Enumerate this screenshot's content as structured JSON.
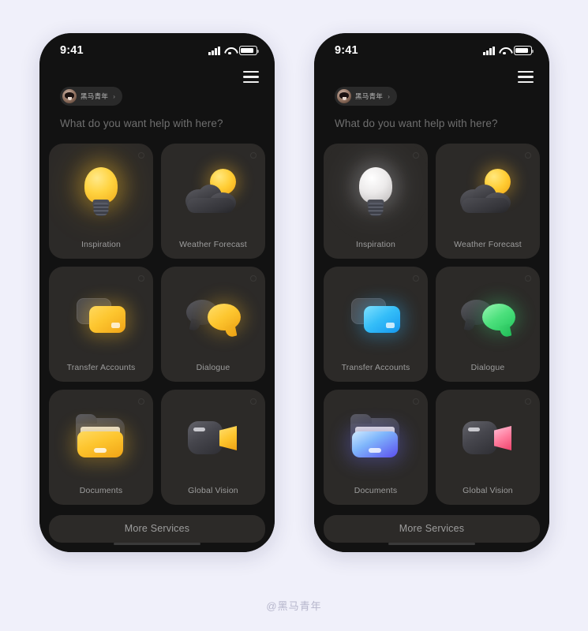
{
  "background_color": "#f0f0fa",
  "watermark": "@黑马青年",
  "phones": [
    {
      "id": "left",
      "statusbar": {
        "time": "9:41"
      },
      "header": {
        "menu_icon": "hamburger-icon",
        "user_name": "黑马青年",
        "chevron": "›",
        "prompt": "What do you want help with here?"
      },
      "cards": [
        {
          "label": "Inspiration",
          "icon": "lightbulb-icon",
          "accent": "#fdc62f"
        },
        {
          "label": "Weather Forecast",
          "icon": "sun-cloud-icon",
          "accent": "#ffcc33"
        },
        {
          "label": "Transfer Accounts",
          "icon": "transfer-cards-icon",
          "accent": "#fdc62f"
        },
        {
          "label": "Dialogue",
          "icon": "chat-bubbles-icon",
          "accent": "#fdc62f"
        },
        {
          "label": "Documents",
          "icon": "folder-icon",
          "accent": "#fdc52e"
        },
        {
          "label": "Global Vision",
          "icon": "video-camera-icon",
          "accent": "#fdc52e"
        }
      ],
      "more_services": "More Services"
    },
    {
      "id": "right",
      "statusbar": {
        "time": "9:41"
      },
      "header": {
        "menu_icon": "hamburger-icon",
        "user_name": "黑马青年",
        "chevron": "›",
        "prompt": "What do you want help with here?"
      },
      "cards": [
        {
          "label": "Inspiration",
          "icon": "lightbulb-icon",
          "accent": "#eceaea"
        },
        {
          "label": "Weather Forecast",
          "icon": "sun-cloud-icon",
          "accent": "#ffcc33"
        },
        {
          "label": "Transfer Accounts",
          "icon": "transfer-cards-icon",
          "accent": "#34bdf8"
        },
        {
          "label": "Dialogue",
          "icon": "chat-bubbles-icon",
          "accent": "#4ce07c"
        },
        {
          "label": "Documents",
          "icon": "folder-icon",
          "accent": "#5b4ef0"
        },
        {
          "label": "Global Vision",
          "icon": "video-camera-icon",
          "accent": "#ff7d9e"
        }
      ],
      "more_services": "More Services"
    }
  ]
}
